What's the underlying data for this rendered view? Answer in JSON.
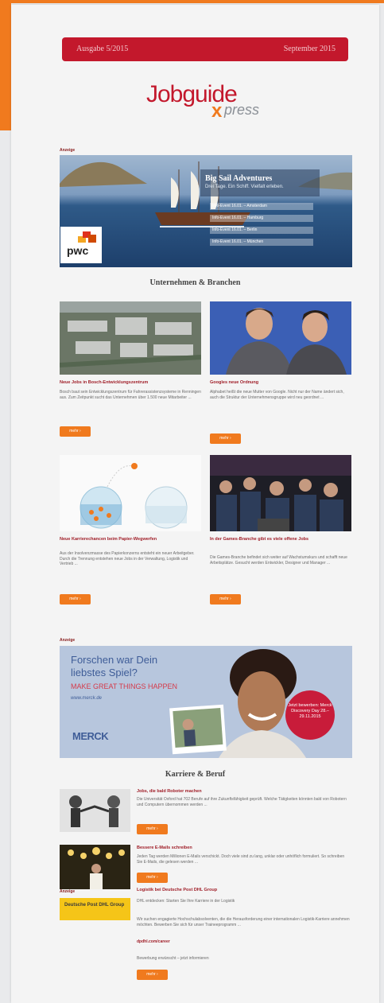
{
  "header": {
    "issue": "Ausgabe 5/2015",
    "date": "September 2015",
    "logo_main": "Jobguide",
    "logo_x": "x",
    "logo_press": "press"
  },
  "ad_label": "Anzeige",
  "banner1": {
    "title": "Big Sail Adventures",
    "subtitle": "Drei Tage. Ein Schiff. Vielfalt erleben.",
    "items": [
      "Info-Event 16.01. – Amsterdam",
      "Info-Event 16.01. – Hamburg",
      "Info-Event 16.01. – Berlin",
      "Info-Event 16.01. – München"
    ],
    "brand": "pwc"
  },
  "section1_title": "Unternehmen & Branchen",
  "articles": [
    {
      "title": "Neue Jobs in Bosch-Entwicklungszentrum",
      "text": "Bosch baut sein Entwicklungszentrum für Fahrerassistenzsysteme in Renningen aus. Zum Zeitpunkt sucht das Unternehmen über 1.500 neue Mitarbeiter ...",
      "button": "mehr ›"
    },
    {
      "title": "Googles neue Ordnung",
      "text": "Alphabet heißt die neue Mutter von Google. Nicht nur der Name ändert sich, auch die Struktur der Unternehmensgruppe wird neu geordnet ...",
      "button": "mehr ›"
    },
    {
      "title": "Neue Karrierechancen beim Papier-Wegwerfen",
      "text": "Aus der Insolvenzmasse des Papierkonzerns entsteht ein neuer Arbeitgeber. Durch die Trennung entstehen neue Jobs in der Verwaltung, Logistik und Vertrieb ...",
      "button": "mehr ›"
    },
    {
      "title": "In der Games-Branche gibt es viele offene Jobs",
      "text": "Die Games-Branche befindet sich weiter auf Wachstumskurs und schafft neue Arbeitsplätze. Gesucht werden Entwickler, Designer und Manager ...",
      "button": "mehr ›"
    }
  ],
  "banner2": {
    "headline": "Forschen war Dein liebstes Spiel?",
    "claim": "MAKE GREAT THINGS HAPPEN",
    "url": "www.merck.de",
    "brand": "MERCK",
    "circle": "Jetzt bewerben: Merck Discovery Day 28.–29.11.2015"
  },
  "section2_title": "Karriere & Beruf",
  "career_items": [
    {
      "title": "Jobs, die bald Roboter machen",
      "text": "Die Universität Oxford hat 702 Berufe auf ihre Zukunftsfähigkeit geprüft. Welche Tätigkeiten könnten bald von Robotern und Computern übernommen werden ...",
      "button": "mehr ›"
    },
    {
      "title": "Bessere E-Mails schreiben",
      "text": "Jeden Tag werden Millionen E-Mails verschickt. Doch viele sind zu lang, unklar oder unhöflich formuliert. So schreiben Sie E-Mails, die gelesen werden ...",
      "button": "mehr ›"
    },
    {
      "title": "Logistik bei Deutsche Post DHL Group",
      "subtitle": "DHL entdecken: Starten Sie Ihre Karriere in der Logistik",
      "text": "Wir suchen engagierte Hochschulabsolventen, die die Herausforderung einer internationalen Logistik-Karriere annehmen möchten. Bewerben Sie sich für unser Traineeprogramm ...",
      "link_text": "dpdhl.com/career",
      "note": "Bewerbung erwünscht – jetzt informieren",
      "button": "mehr ›",
      "brand": "Deutsche Post DHL Group"
    }
  ]
}
